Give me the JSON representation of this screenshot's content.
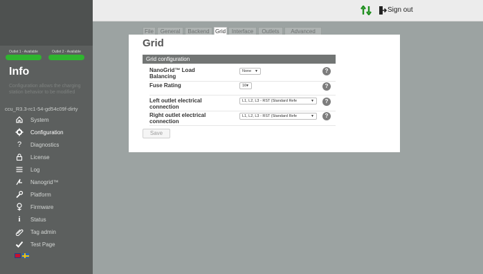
{
  "topbar": {
    "signout_label": "Sign out",
    "arrows_color": "#1f8f1f"
  },
  "sidebar": {
    "outlets": [
      {
        "label": "Outlet 1 - Available",
        "color": "#2fb52f"
      },
      {
        "label": "Outlet 2 - Available",
        "color": "#2fb52f"
      }
    ],
    "info_title": "Info",
    "info_desc": "Configuration allows the charging station behavior to be modified",
    "version": "ccu_R3.3-rc1-54-gd54c09f-dirty",
    "items": [
      {
        "label": "System",
        "icon": "home-icon"
      },
      {
        "label": "Configuration",
        "icon": "gear-icon",
        "active": true
      },
      {
        "label": "Diagnostics",
        "icon": "question-icon"
      },
      {
        "label": "License",
        "icon": "lock-icon"
      },
      {
        "label": "Log",
        "icon": "list-icon"
      },
      {
        "label": "Nanogrid™",
        "icon": "nanogrid-icon"
      },
      {
        "label": "Platform",
        "icon": "wrench-icon"
      },
      {
        "label": "Firmware",
        "icon": "firmware-icon"
      },
      {
        "label": "Status",
        "icon": "info-icon"
      },
      {
        "label": "Tag admin",
        "icon": "tag-icon"
      },
      {
        "label": "Test Page",
        "icon": "check-icon"
      }
    ]
  },
  "tabs": [
    {
      "label": "File"
    },
    {
      "label": "General"
    },
    {
      "label": "Backend"
    },
    {
      "label": "Grid",
      "active": true
    },
    {
      "label": "Interface"
    },
    {
      "label": "Outlets"
    },
    {
      "label": "Advanced"
    }
  ],
  "main": {
    "title": "Grid",
    "section": "Grid configuration",
    "rows": [
      {
        "label": "NanoGrid™ Load Balancing",
        "value": "None"
      },
      {
        "label": "Fuse Rating",
        "value": "16"
      },
      {
        "label": "Left outlet electrical connection",
        "value": "L1, L2, L3 - RST (Standard Refe"
      },
      {
        "label": "Right outlet electrical connection",
        "value": "L1, L2, L3 - RST (Standard Refe"
      }
    ],
    "save_label": "Save"
  }
}
